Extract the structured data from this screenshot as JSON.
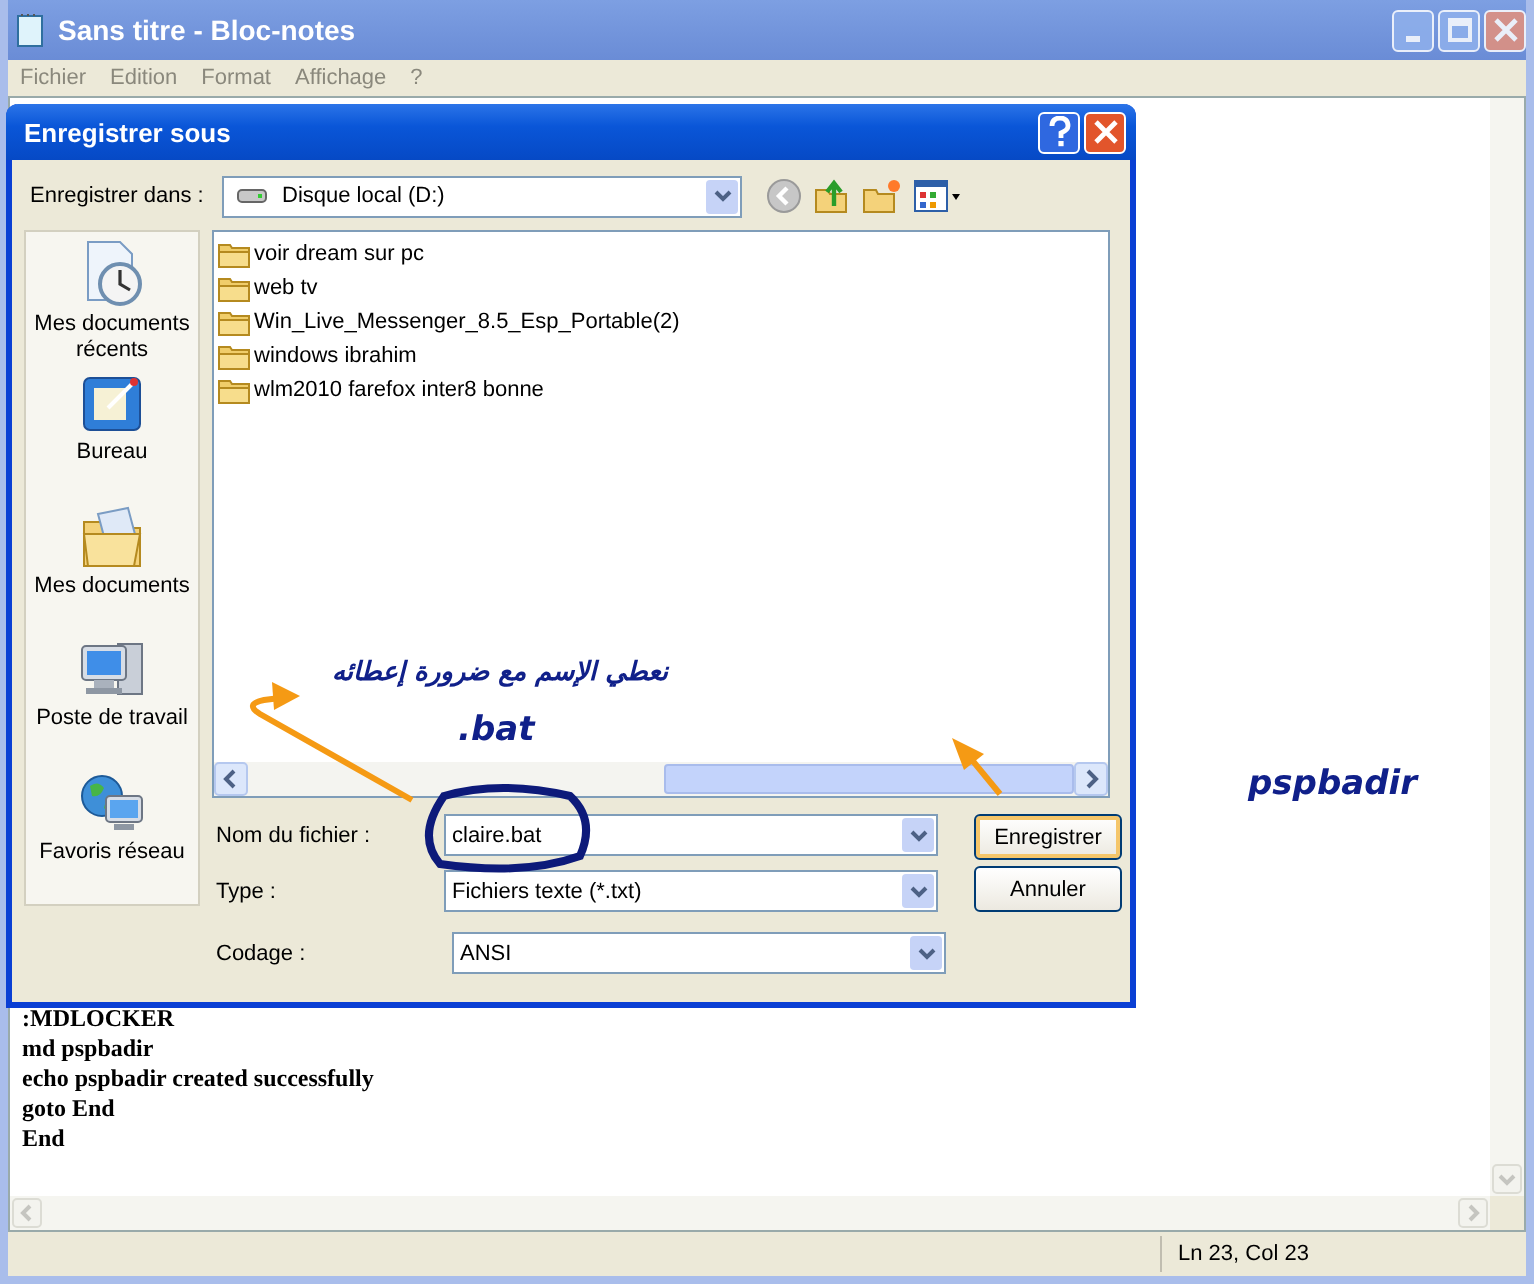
{
  "notepad": {
    "title": "Sans titre - Bloc-notes",
    "menu": [
      "Fichier",
      "Edition",
      "Format",
      "Affichage",
      "?"
    ],
    "lines": [
      ":MDLOCKER",
      "md pspbadir",
      "echo pspbadir created successfully",
      "goto End",
      "End"
    ],
    "status": "Ln 23, Col 23"
  },
  "dialog": {
    "title": "Enregistrer sous",
    "save_in_label": "Enregistrer dans :",
    "save_in_value": "Disque local (D:)",
    "places": [
      {
        "label": "Mes documents récents",
        "kind": "recent"
      },
      {
        "label": "Bureau",
        "kind": "desktop"
      },
      {
        "label": "Mes documents",
        "kind": "documents"
      },
      {
        "label": "Poste de travail",
        "kind": "computer"
      },
      {
        "label": "Favoris réseau",
        "kind": "network"
      }
    ],
    "files": [
      "voir dream sur pc",
      "web tv",
      "Win_Live_Messenger_8.5_Esp_Portable(2)",
      "windows ibrahim",
      "wlm2010 farefox inter8 bonne"
    ],
    "fields": [
      {
        "label": "Nom du fichier :",
        "value": "claire.bat"
      },
      {
        "label": "Type :",
        "value": "Fichiers texte (*.txt)"
      },
      {
        "label": "Codage :",
        "value": "ANSI"
      }
    ],
    "buttons": [
      {
        "label": "Enregistrer",
        "kind": "default"
      },
      {
        "label": "Annuler",
        "kind": "normal"
      }
    ]
  },
  "annotations": {
    "note": "نعطي الإسم مع ضرورة إعطائه",
    "note_ext": ".bat",
    "signature": "pspbadir"
  }
}
